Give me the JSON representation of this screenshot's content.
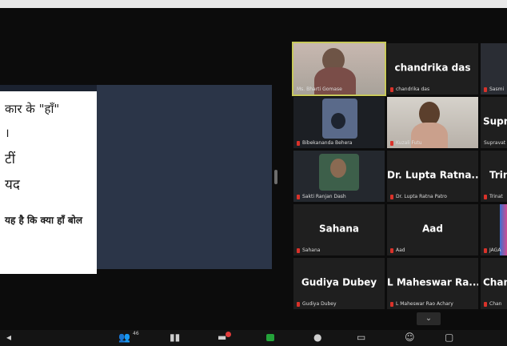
{
  "slide": {
    "line1": "कार के \"हाँ\"",
    "line2": "।",
    "line3": "टीं",
    "line4": "यद",
    "line5": "यह है कि क्या हाँ बोल"
  },
  "tiles": [
    {
      "label": "Ms. Bharti Gomase",
      "big": ""
    },
    {
      "label": "chandrika das",
      "big": "chandrika das"
    },
    {
      "label": "Sasmi",
      "big": ""
    },
    {
      "label": "Bibekananda Behera",
      "big": ""
    },
    {
      "label": "Kuzali Futu",
      "big": ""
    },
    {
      "label": "Supravat",
      "big": "Supra"
    },
    {
      "label": "Sakti Ranjan Dash",
      "big": ""
    },
    {
      "label": "Dr. Lupta Ratna Patro",
      "big": "Dr. Lupta Ratna..."
    },
    {
      "label": "Trinat",
      "big": "Trin"
    },
    {
      "label": "Sahana",
      "big": "Sahana"
    },
    {
      "label": "Aad",
      "big": "Aad"
    },
    {
      "label": "JAGA",
      "big": ""
    },
    {
      "label": "Gudiya Dubey",
      "big": "Gudiya Dubey"
    },
    {
      "label": "L Maheswar Rao Achary",
      "big": "L Maheswar Ra..."
    },
    {
      "label": "Chan",
      "big": "Chan"
    }
  ],
  "toolbar": {
    "participants_count": "46",
    "chevron": "⌄"
  },
  "colors": {
    "active_border": "#c7c85a",
    "mic_muted": "#d9322a"
  }
}
